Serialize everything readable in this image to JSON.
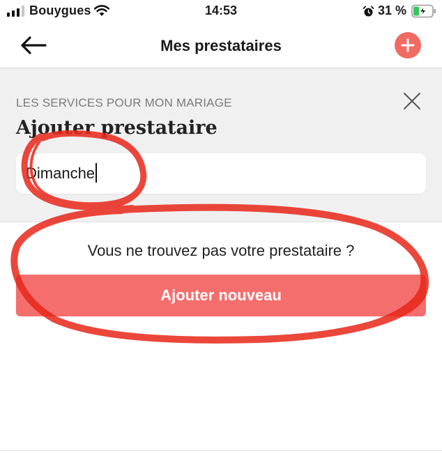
{
  "status_bar": {
    "carrier": "Bouygues",
    "time": "14:53",
    "battery_percent": "31 %",
    "battery_level": 0.31,
    "icons": [
      "signal-icon",
      "wifi-icon",
      "alarm-icon",
      "battery-charging-icon"
    ]
  },
  "nav": {
    "title": "Mes prestataires",
    "back_icon": "arrow-left-icon",
    "add_icon": "plus-icon"
  },
  "panel": {
    "eyebrow": "LES SERVICES POUR MON MARIAGE",
    "title": "Ajouter prestataire",
    "search_value": "Dimanche",
    "close_icon": "close-icon"
  },
  "empty": {
    "message": "Vous ne trouvez pas votre prestataire ?",
    "button_label": "Ajouter nouveau"
  },
  "colors": {
    "accent": "#f26b62",
    "button": "#f56e6e",
    "panel_bg": "#f0f0f0",
    "annotation_red": "#e8271a"
  }
}
